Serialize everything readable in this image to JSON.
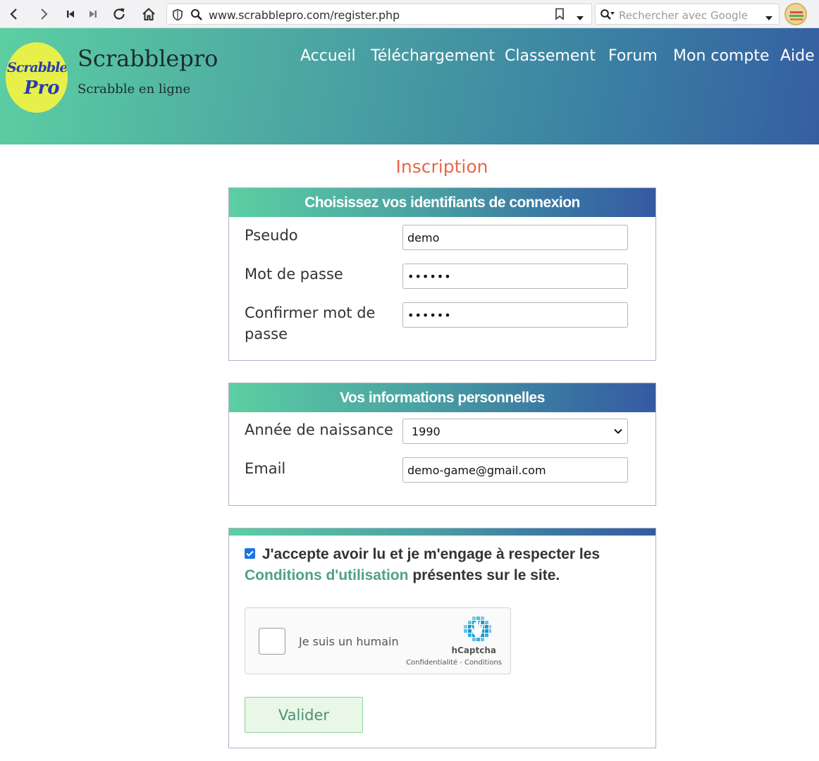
{
  "browser": {
    "url": "www.scrabblepro.com/register.php",
    "search_placeholder": "Rechercher avec Google"
  },
  "site": {
    "title": "Scrabblepro",
    "subtitle": "Scrabble en ligne",
    "logo_text_1": "Scrabble",
    "logo_text_2": "Pro",
    "nav": [
      "Accueil",
      "Téléchargement",
      "Classement",
      "Forum",
      "Mon compte",
      "Aide"
    ]
  },
  "page": {
    "heading": "Inscription"
  },
  "login_section": {
    "title": "Choisissez vos identifiants de connexion",
    "pseudo_label": "Pseudo",
    "pseudo_value": "demo",
    "password_label": "Mot de passe",
    "password_value": "••••••",
    "confirm_label": "Confirmer mot de passe",
    "confirm_value": "••••••"
  },
  "personal_section": {
    "title": "Vos informations personnelles",
    "birth_label": "Année de naissance",
    "birth_value": "1990",
    "email_label": "Email",
    "email_value": "demo-game@gmail.com"
  },
  "terms_section": {
    "accept_prefix": "J'accepte avoir lu et je m'engage à respecter les",
    "terms_link": "Conditions d'utilisation",
    "accept_suffix": "présentes sur le site.",
    "accepted": true
  },
  "captcha": {
    "label": "Je suis un humain",
    "brand": "hCaptcha",
    "links": "Confidentialité - Conditions"
  },
  "submit_label": "Valider",
  "colors": {
    "heading": "#e8664c",
    "link": "#4fa08a",
    "gradient_start": "#5ccfa2",
    "gradient_end": "#355ea2"
  }
}
